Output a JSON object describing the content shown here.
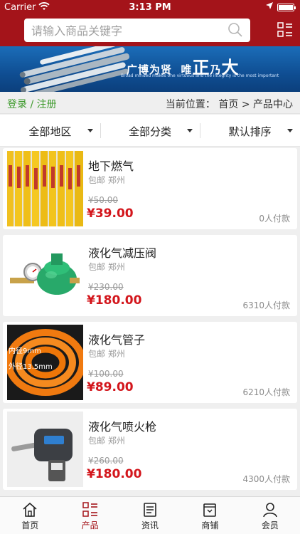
{
  "status_bar": {
    "carrier": "Carrier",
    "time": "3:13 PM"
  },
  "header": {
    "search_placeholder": "请输入商品关键字",
    "search_icon": "search-icon",
    "menu_icon": "grid-menu-icon",
    "accent_color": "#a4141a"
  },
  "banner": {
    "slogan_part1": "广博为贤",
    "slogan_part2": "唯",
    "slogan_big1": "正",
    "slogan_part3": "乃",
    "slogan_big2": "大",
    "tagline": "Broad minded makes one virtuous and the integrity is the most important"
  },
  "breadcrumb": {
    "login": "登录",
    "separator": "/",
    "register": "注册",
    "location_label": "当前位置：",
    "home": "首页",
    "arrow": ">",
    "current": "产品中心"
  },
  "filters": [
    {
      "label": "全部地区"
    },
    {
      "label": "全部分类"
    },
    {
      "label": "默认排序"
    }
  ],
  "products": [
    {
      "title": "地下燃气",
      "shipping": "包邮 郑州",
      "old_price": "¥50.00",
      "price": "¥39.00",
      "sold": "0人付款",
      "image": "marker-posts"
    },
    {
      "title": "液化气减压阀",
      "shipping": "包邮 郑州",
      "old_price": "¥230.00",
      "price": "¥180.00",
      "sold": "6310人付款",
      "image": "pressure-valve"
    },
    {
      "title": "液化气管子",
      "shipping": "包邮 郑州",
      "old_price": "¥100.00",
      "price": "¥89.00",
      "sold": "6210人付款",
      "image": "gas-hose",
      "image_text": [
        "内径9mm",
        "外径13.5mm"
      ]
    },
    {
      "title": "液化气喷火枪",
      "shipping": "包邮 郑州",
      "old_price": "¥260.00",
      "price": "¥180.00",
      "sold": "4300人付款",
      "image": "torch-gun"
    }
  ],
  "tabbar": [
    {
      "label": "首页",
      "icon": "home-icon"
    },
    {
      "label": "产品",
      "icon": "product-list-icon",
      "active": true
    },
    {
      "label": "资讯",
      "icon": "news-icon"
    },
    {
      "label": "商铺",
      "icon": "shop-icon"
    },
    {
      "label": "会员",
      "icon": "member-icon"
    }
  ]
}
